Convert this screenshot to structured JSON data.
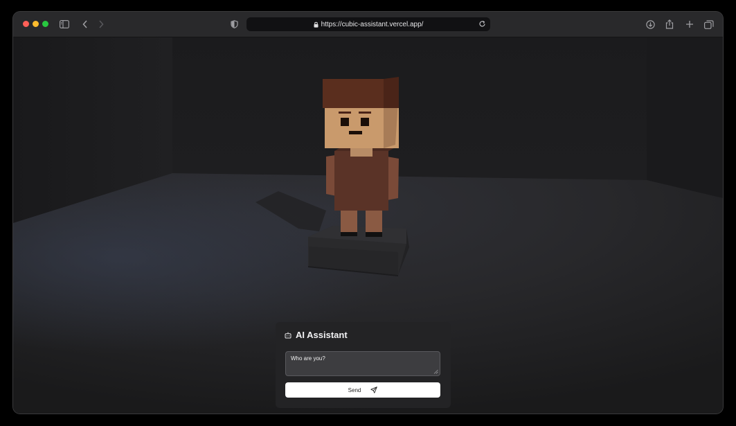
{
  "browser": {
    "url": "https://cubic-assistant.vercel.app/",
    "icons": [
      "sidebar-icon",
      "back-icon",
      "forward-icon",
      "shield-icon",
      "lock-icon",
      "reload-icon",
      "download-icon",
      "share-icon",
      "new-tab-icon",
      "tabs-overview-icon"
    ]
  },
  "assistant": {
    "title": "AI Assistant",
    "input_value": "Who are you?",
    "send_label": "Send",
    "icons": [
      "robot-icon",
      "send-icon"
    ]
  },
  "colors": {
    "window_bg": "#1e1e20",
    "toolbar_bg": "#29292b",
    "panel_bg": "#232325",
    "hair": "#5a2e1e",
    "skin": "#c99a6c",
    "shirt": "#5a3327",
    "button_bg": "#ffffff"
  }
}
